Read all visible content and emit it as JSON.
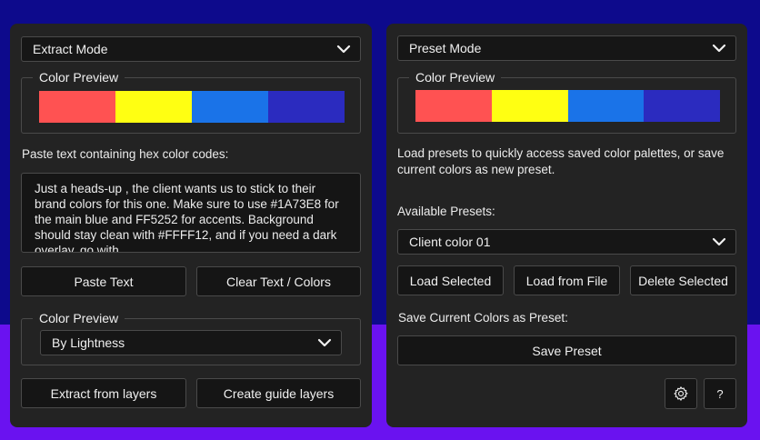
{
  "colors": {
    "red": "#ff5252",
    "yellow": "#ffff12",
    "blue": "#1a73e8",
    "indigo": "#2b2bbf"
  },
  "left": {
    "mode_dropdown": {
      "value": "Extract Mode"
    },
    "preview": {
      "title": "Color Preview"
    },
    "paste_prompt": "Paste text containing hex color codes:",
    "text_area": {
      "value": "Just a heads-up ,  the client wants us to stick to their brand colors for this one. Make sure to use #1A73E8 for the main blue and FF5252 for accents. Background should stay clean with #FFFF12, and if you need a dark overlay, go with"
    },
    "paste_button": "Paste Text",
    "clear_button": "Clear Text / Colors",
    "sort_group": {
      "title": "Color Preview",
      "dropdown_value": "By Lightness"
    },
    "extract_button": "Extract from layers",
    "guide_button": "Create guide layers"
  },
  "right": {
    "mode_dropdown": {
      "value": "Preset Mode"
    },
    "preview": {
      "title": "Color Preview"
    },
    "description": "Load presets to quickly access saved color palettes, or save current colors as new preset.",
    "available_label": "Available Presets:",
    "preset_dropdown": {
      "value": "Client color 01"
    },
    "load_selected": "Load Selected",
    "load_file": "Load from File",
    "delete_selected": "Delete Selected",
    "save_label": "Save Current Colors as Preset:",
    "save_button": "Save Preset",
    "help_button": "?",
    "settings_icon": "gear-icon"
  }
}
